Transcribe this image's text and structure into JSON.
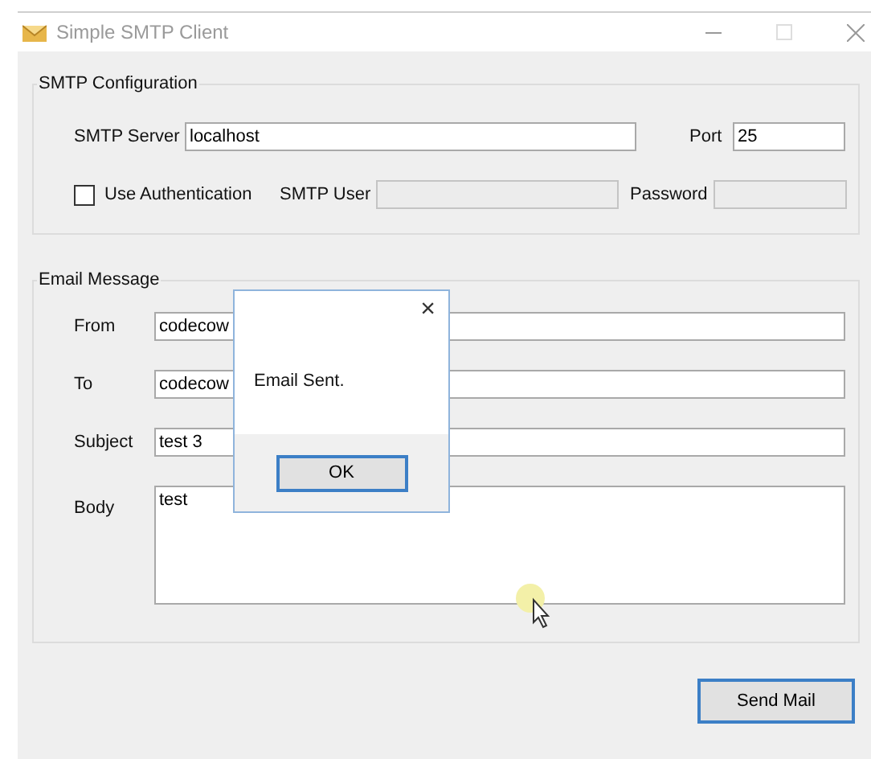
{
  "window": {
    "title": "Simple SMTP Client"
  },
  "smtp_configuration": {
    "title": "SMTP Configuration",
    "server_label": "SMTP Server",
    "server": "localhost",
    "port_label": "Port",
    "port": "25",
    "use_authentication": {
      "label": "Use Authentication",
      "checked": false
    },
    "user_label": "SMTP User",
    "password_label": "Password",
    "credentials_disabled": true
  },
  "email_message": {
    "title": "Email Message",
    "fields": [
      {
        "label": "From",
        "value": "codecow"
      },
      {
        "label": "To",
        "value": "codecow"
      },
      {
        "label": "Subject",
        "value": "test 3"
      }
    ],
    "body_label": "Body",
    "body": "test"
  },
  "send_button": "Send Mail",
  "dialog": {
    "message": "Email Sent.",
    "close": "×",
    "button": "OK"
  }
}
